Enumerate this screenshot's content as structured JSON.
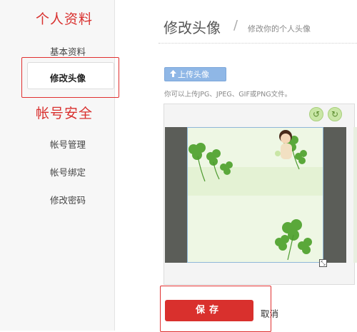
{
  "sidebar": {
    "personal_title": "个人资料",
    "items_personal": [
      {
        "label": "基本资料"
      },
      {
        "label": "修改头像",
        "active": true
      }
    ],
    "account_title": "帐号安全",
    "items_account": [
      {
        "label": "帐号管理"
      },
      {
        "label": "帐号绑定"
      },
      {
        "label": "修改密码"
      }
    ]
  },
  "main": {
    "title": "修改头像",
    "subtitle": "修改你的个人头像",
    "upload_label": "上传头像",
    "hint": "你可以上传JPG、JPEG、GIF或PNG文件。",
    "rotate_left_icon": "rotate-left-icon",
    "rotate_right_icon": "rotate-right-icon",
    "save_label": "保存",
    "cancel_label": "取消"
  },
  "colors": {
    "accent_red": "#d9302d",
    "upload_blue": "#8fb7e6",
    "rotate_green": "#c9e6a6"
  }
}
